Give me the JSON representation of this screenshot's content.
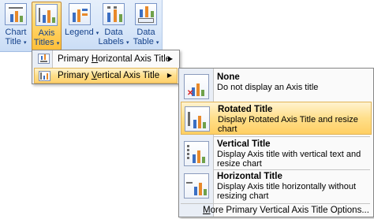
{
  "ribbon": {
    "buttons": [
      {
        "name": "chart-title-button",
        "line1": "Chart",
        "line2": "Title",
        "icon": "chart-title-icon"
      },
      {
        "name": "axis-titles-button",
        "line1": "Axis",
        "line2": "Titles",
        "icon": "axis-titles-icon"
      },
      {
        "name": "legend-button",
        "line1": "Legend",
        "line2": "",
        "icon": "legend-icon"
      },
      {
        "name": "data-labels-button",
        "line1": "Data",
        "line2": "Labels",
        "icon": "data-labels-icon"
      },
      {
        "name": "data-table-button",
        "line1": "Data",
        "line2": "Table",
        "icon": "data-table-icon"
      }
    ],
    "caret": "▾"
  },
  "axis_menu": {
    "items": [
      {
        "pre": "Primary ",
        "ul": "H",
        "post": "orizontal Axis Title",
        "arrow": "▶"
      },
      {
        "pre": "Primary ",
        "ul": "V",
        "post": "ertical Axis Title",
        "arrow": "▶"
      }
    ]
  },
  "vertical_menu": {
    "items": [
      {
        "title": "None",
        "desc": "Do not display an Axis title",
        "icon": "no-axis-title-icon"
      },
      {
        "title": "Rotated Title",
        "desc": "Display Rotated Axis Title and resize chart",
        "icon": "rotated-title-icon"
      },
      {
        "title": "Vertical Title",
        "desc": "Display Axis title with vertical text and resize chart",
        "icon": "vertical-title-icon"
      },
      {
        "title": "Horizontal Title",
        "desc": "Display Axis title horizontally without resizing chart",
        "icon": "horizontal-title-icon"
      }
    ],
    "more": {
      "pre": "",
      "ul": "M",
      "post": "ore Primary Vertical Axis Title Options..."
    }
  },
  "colors": {
    "ribbon_text": "#15428b",
    "highlight": "#ffd66b",
    "menu_border": "#868686",
    "bar_blue": "#3b6fc3",
    "bar_orange": "#e8892a",
    "bar_green": "#6fa14a"
  }
}
